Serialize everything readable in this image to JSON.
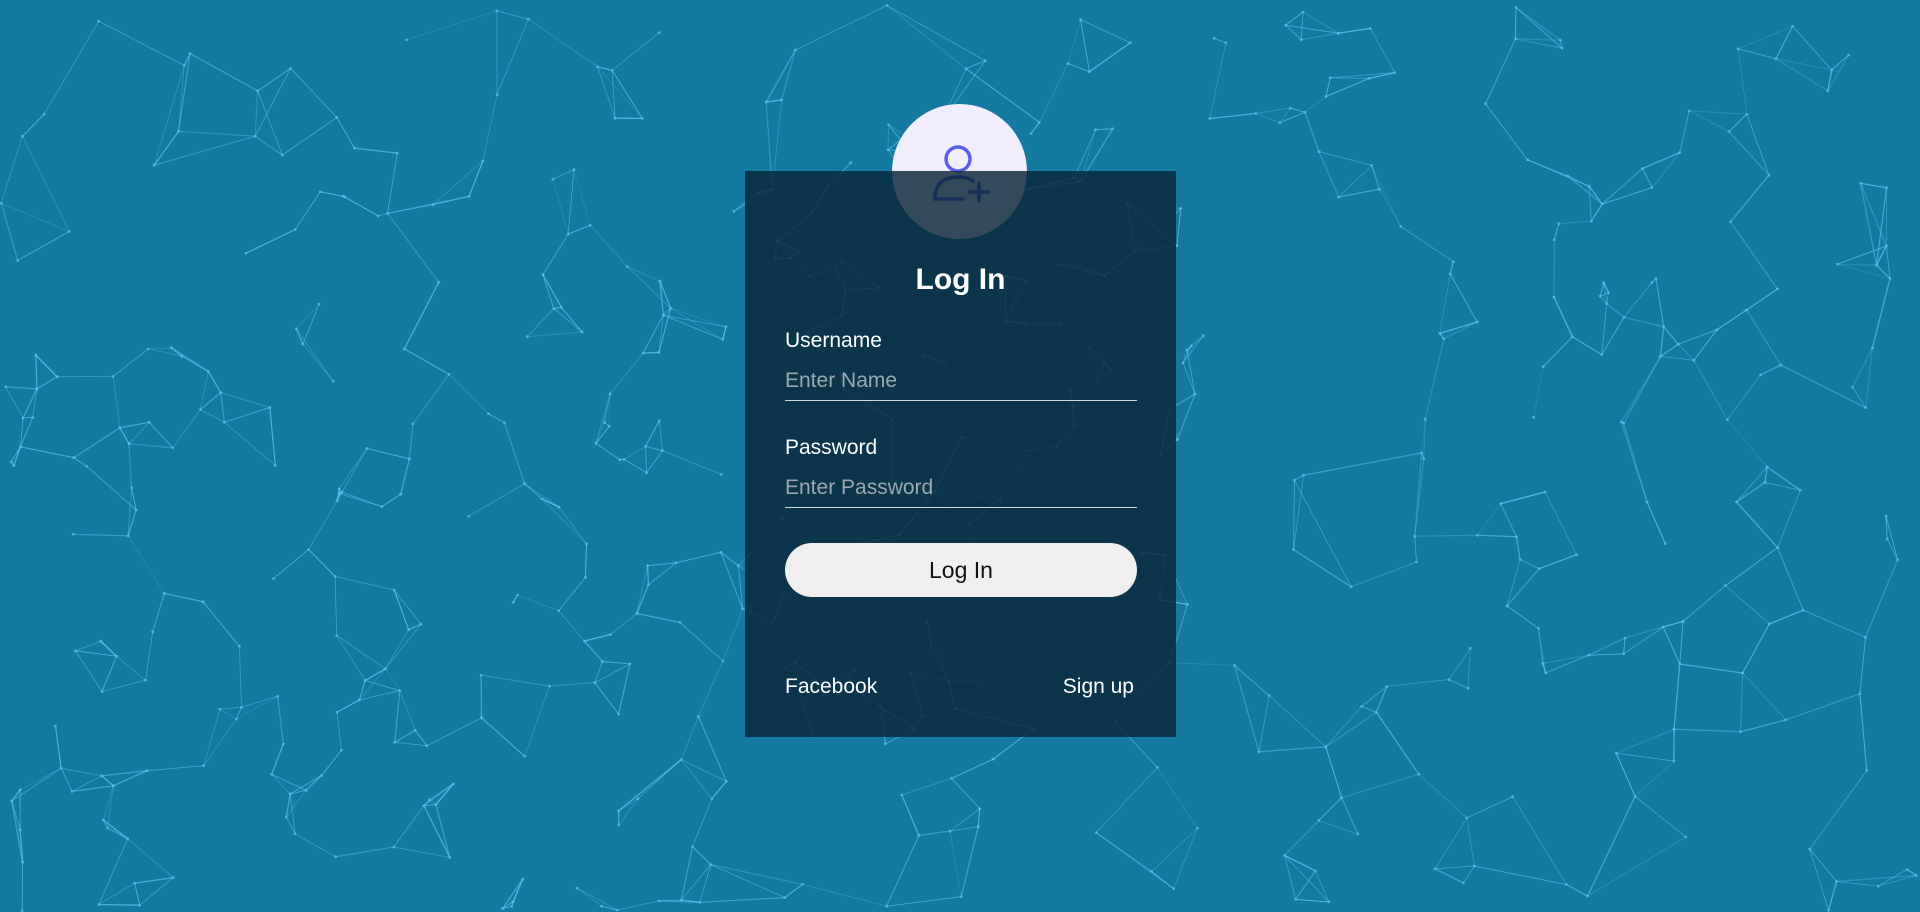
{
  "colors": {
    "background": "#157aa0",
    "network_line": "#5fc4ec",
    "panel": "#08263a",
    "avatar_bg": "#f0eefc",
    "avatar_icon": "#5b5ee6"
  },
  "login": {
    "avatar_icon": "user-plus-icon",
    "title": "Log In",
    "username": {
      "label": "Username",
      "placeholder": "Enter Name",
      "value": ""
    },
    "password": {
      "label": "Password",
      "placeholder": "Enter Password",
      "value": ""
    },
    "submit_label": "Log In",
    "facebook_link": "Facebook",
    "signup_link": "Sign up"
  }
}
